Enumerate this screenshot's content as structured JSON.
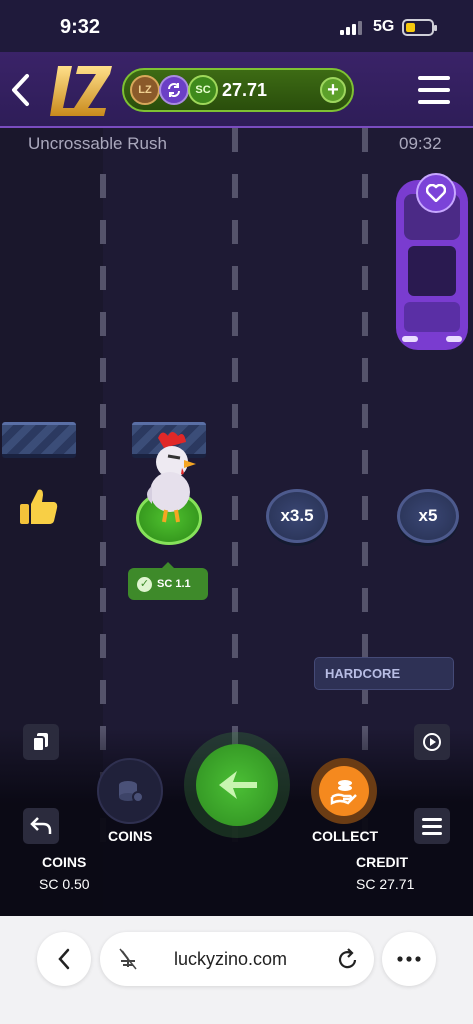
{
  "status_bar": {
    "time": "9:32",
    "network": "5G"
  },
  "header": {
    "balance": "27.71",
    "coin_lz": "LZ",
    "coin_sc": "SC",
    "plus_label": "+"
  },
  "game": {
    "title": "Uncrossable Rush",
    "clock": "09:32",
    "multipliers": [
      "x3.5",
      "x5"
    ],
    "current_win": "SC 1.1",
    "mode": "HARDCORE"
  },
  "controls": {
    "coins_label": "COINS",
    "collect_label": "COLLECT",
    "coins_title": "COINS",
    "coins_value": "SC 0.50",
    "credit_title": "CREDIT",
    "credit_value": "SC 27.71"
  },
  "browser": {
    "url": "luckyzino.com"
  },
  "colors": {
    "accent_purple": "#7b43d8",
    "go_green": "#3ea82a",
    "collect_orange": "#f5891e"
  }
}
